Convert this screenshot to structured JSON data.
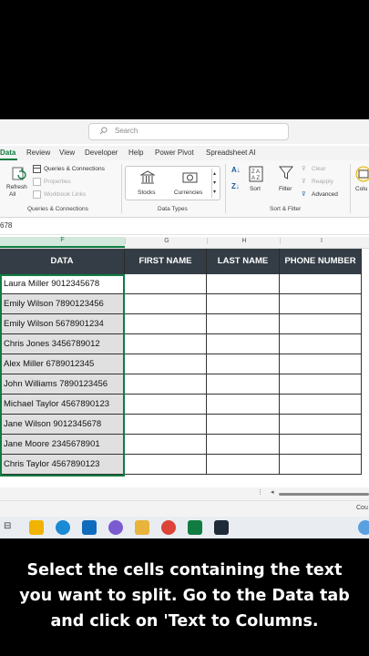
{
  "search": {
    "placeholder": "Search"
  },
  "tabs": [
    "Data",
    "Review",
    "View",
    "Developer",
    "Help",
    "Power Pivot",
    "Spreadsheet AI"
  ],
  "active_tab": "Data",
  "ribbon": {
    "refresh_all": "Refresh",
    "refresh_all_2": "All",
    "queries_connections": "Queries & Connections",
    "properties": "Properties",
    "workbook_links": "Workbook Links",
    "group_queries": "Queries & Connections",
    "stocks": "Stocks",
    "currencies": "Currencies",
    "group_datatypes": "Data Types",
    "sort": "Sort",
    "filter": "Filter",
    "clear": "Clear",
    "reapply": "Reapply",
    "advanced": "Advanced",
    "group_sortfilter": "Sort & Filter",
    "text_to_columns_partial": "Colu"
  },
  "name_box": "678",
  "columns": [
    "F",
    "G",
    "H",
    "I"
  ],
  "table": {
    "headers": [
      "DATA",
      "FIRST NAME",
      "LAST NAME",
      "PHONE NUMBER"
    ],
    "rows": [
      "Laura Miller 9012345678",
      "Emily Wilson 7890123456",
      "Emily Wilson 5678901234",
      "Chris Jones 3456789012",
      "Alex Miller 6789012345",
      "John Williams 7890123456",
      "Michael Taylor 4567890123",
      "Jane Wilson 9012345678",
      "Jane Moore 2345678901",
      "Chris Taylor 4567890123"
    ]
  },
  "status": {
    "right_text": "Cou"
  },
  "caption": [
    "Select the cells containing the text",
    "you want to split. Go to the Data tab",
    "and click on 'Text to Columns."
  ],
  "colors": {
    "accent": "#107c41",
    "header_bg": "#343d46",
    "selection_fill": "#e0e0e0"
  }
}
